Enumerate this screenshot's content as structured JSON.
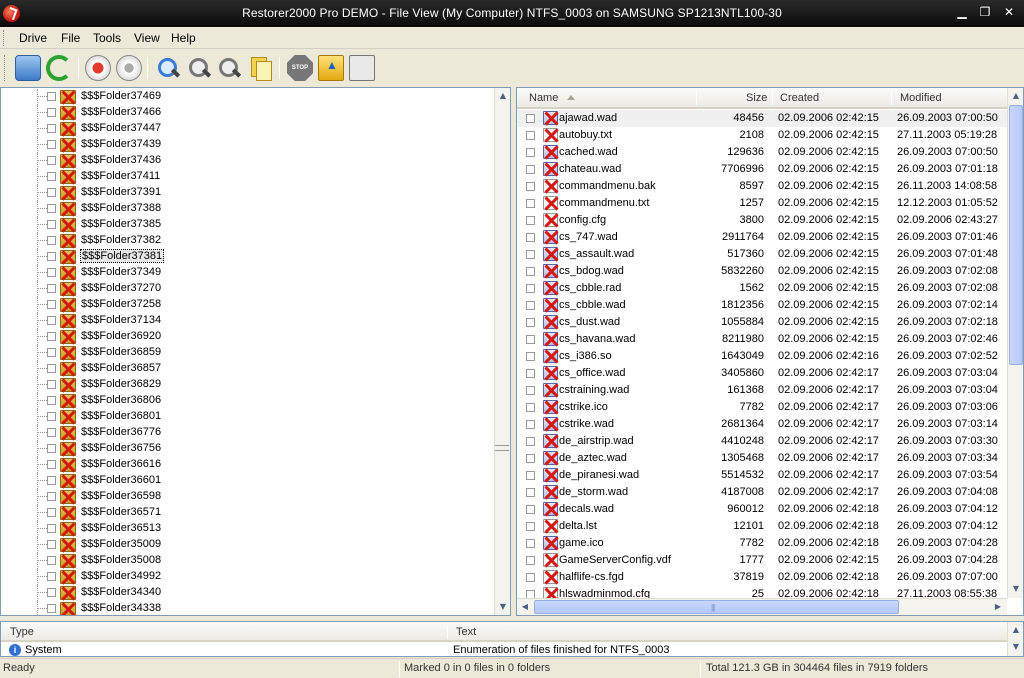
{
  "window": {
    "title": "Restorer2000 Pro DEMO - File View (My Computer) NTFS_0003 on SAMSUNG SP1213NTL100-30"
  },
  "menu": [
    {
      "label": "Drive"
    },
    {
      "label": "File"
    },
    {
      "label": "Tools"
    },
    {
      "label": "View"
    },
    {
      "label": "Help"
    }
  ],
  "toolbar": {
    "buttons": [
      {
        "icon": "drive-icon"
      },
      {
        "icon": "refresh-icon"
      },
      {
        "icon": "mark-icon"
      },
      {
        "icon": "unmark-icon"
      },
      {
        "icon": "find-icon"
      },
      {
        "icon": "find-next-icon"
      },
      {
        "icon": "find-files-icon"
      },
      {
        "icon": "copy-icon"
      },
      {
        "icon": "stop-icon"
      },
      {
        "icon": "up-folder-icon"
      },
      {
        "icon": "properties-icon"
      }
    ]
  },
  "tree": {
    "selected": "$$$Folder37381",
    "items": [
      "$$$Folder37469",
      "$$$Folder37466",
      "$$$Folder37447",
      "$$$Folder37439",
      "$$$Folder37436",
      "$$$Folder37411",
      "$$$Folder37391",
      "$$$Folder37388",
      "$$$Folder37385",
      "$$$Folder37382",
      "$$$Folder37381",
      "$$$Folder37349",
      "$$$Folder37270",
      "$$$Folder37258",
      "$$$Folder37134",
      "$$$Folder36920",
      "$$$Folder36859",
      "$$$Folder36857",
      "$$$Folder36829",
      "$$$Folder36806",
      "$$$Folder36801",
      "$$$Folder36776",
      "$$$Folder36756",
      "$$$Folder36616",
      "$$$Folder36601",
      "$$$Folder36598",
      "$$$Folder36571",
      "$$$Folder36513",
      "$$$Folder35009",
      "$$$Folder35008",
      "$$$Folder34992",
      "$$$Folder34340",
      "$$$Folder34338"
    ]
  },
  "list": {
    "columns": {
      "name": "Name",
      "size": "Size",
      "created": "Created",
      "modified": "Modified"
    },
    "rows": [
      {
        "name": "ajawad.wad",
        "size": "48456",
        "created": "02.09.2006 02:42:15",
        "modified": "26.09.2003 07:00:50",
        "icon": "deleted-file-icon"
      },
      {
        "name": "autobuy.txt",
        "size": "2108",
        "created": "02.09.2006 02:42:15",
        "modified": "27.11.2003 05:19:28",
        "icon": "deleted-text-icon"
      },
      {
        "name": "cached.wad",
        "size": "129636",
        "created": "02.09.2006 02:42:15",
        "modified": "26.09.2003 07:00:50",
        "icon": "deleted-file-icon"
      },
      {
        "name": "chateau.wad",
        "size": "7706996",
        "created": "02.09.2006 02:42:15",
        "modified": "26.09.2003 07:01:18",
        "icon": "deleted-file-icon"
      },
      {
        "name": "commandmenu.bak",
        "size": "8597",
        "created": "02.09.2006 02:42:15",
        "modified": "26.11.2003 14:08:58",
        "icon": "deleted-text-icon"
      },
      {
        "name": "commandmenu.txt",
        "size": "1257",
        "created": "02.09.2006 02:42:15",
        "modified": "12.12.2003 01:05:52",
        "icon": "deleted-text-icon"
      },
      {
        "name": "config.cfg",
        "size": "3800",
        "created": "02.09.2006 02:42:15",
        "modified": "02.09.2006 02:43:27",
        "icon": "deleted-text-icon"
      },
      {
        "name": "cs_747.wad",
        "size": "2911764",
        "created": "02.09.2006 02:42:15",
        "modified": "26.09.2003 07:01:46",
        "icon": "deleted-file-icon"
      },
      {
        "name": "cs_assault.wad",
        "size": "517360",
        "created": "02.09.2006 02:42:15",
        "modified": "26.09.2003 07:01:48",
        "icon": "deleted-file-icon"
      },
      {
        "name": "cs_bdog.wad",
        "size": "5832260",
        "created": "02.09.2006 02:42:15",
        "modified": "26.09.2003 07:02:08",
        "icon": "deleted-file-icon"
      },
      {
        "name": "cs_cbble.rad",
        "size": "1562",
        "created": "02.09.2006 02:42:15",
        "modified": "26.09.2003 07:02:08",
        "icon": "deleted-file-icon"
      },
      {
        "name": "cs_cbble.wad",
        "size": "1812356",
        "created": "02.09.2006 02:42:15",
        "modified": "26.09.2003 07:02:14",
        "icon": "deleted-file-icon"
      },
      {
        "name": "cs_dust.wad",
        "size": "1055884",
        "created": "02.09.2006 02:42:15",
        "modified": "26.09.2003 07:02:18",
        "icon": "deleted-file-icon"
      },
      {
        "name": "cs_havana.wad",
        "size": "8211980",
        "created": "02.09.2006 02:42:15",
        "modified": "26.09.2003 07:02:46",
        "icon": "deleted-file-icon"
      },
      {
        "name": "cs_i386.so",
        "size": "1643049",
        "created": "02.09.2006 02:42:16",
        "modified": "26.09.2003 07:02:52",
        "icon": "deleted-file-icon"
      },
      {
        "name": "cs_office.wad",
        "size": "3405860",
        "created": "02.09.2006 02:42:17",
        "modified": "26.09.2003 07:03:04",
        "icon": "deleted-file-icon"
      },
      {
        "name": "cstraining.wad",
        "size": "161368",
        "created": "02.09.2006 02:42:17",
        "modified": "26.09.2003 07:03:04",
        "icon": "deleted-file-icon"
      },
      {
        "name": "cstrike.ico",
        "size": "7782",
        "created": "02.09.2006 02:42:17",
        "modified": "26.09.2003 07:03:06",
        "icon": "deleted-file-icon"
      },
      {
        "name": "cstrike.wad",
        "size": "2681364",
        "created": "02.09.2006 02:42:17",
        "modified": "26.09.2003 07:03:14",
        "icon": "deleted-file-icon"
      },
      {
        "name": "de_airstrip.wad",
        "size": "4410248",
        "created": "02.09.2006 02:42:17",
        "modified": "26.09.2003 07:03:30",
        "icon": "deleted-file-icon"
      },
      {
        "name": "de_aztec.wad",
        "size": "1305468",
        "created": "02.09.2006 02:42:17",
        "modified": "26.09.2003 07:03:34",
        "icon": "deleted-file-icon"
      },
      {
        "name": "de_piranesi.wad",
        "size": "5514532",
        "created": "02.09.2006 02:42:17",
        "modified": "26.09.2003 07:03:54",
        "icon": "deleted-file-icon"
      },
      {
        "name": "de_storm.wad",
        "size": "4187008",
        "created": "02.09.2006 02:42:17",
        "modified": "26.09.2003 07:04:08",
        "icon": "deleted-file-icon"
      },
      {
        "name": "decals.wad",
        "size": "960012",
        "created": "02.09.2006 02:42:18",
        "modified": "26.09.2003 07:04:12",
        "icon": "deleted-file-icon"
      },
      {
        "name": "delta.lst",
        "size": "12101",
        "created": "02.09.2006 02:42:18",
        "modified": "26.09.2003 07:04:12",
        "icon": "deleted-text-icon"
      },
      {
        "name": "game.ico",
        "size": "7782",
        "created": "02.09.2006 02:42:18",
        "modified": "26.09.2003 07:04:28",
        "icon": "deleted-file-icon"
      },
      {
        "name": "GameServerConfig.vdf",
        "size": "1777",
        "created": "02.09.2006 02:42:15",
        "modified": "26.09.2003 07:04:28",
        "icon": "deleted-text-icon"
      },
      {
        "name": "halflife-cs.fgd",
        "size": "37819",
        "created": "02.09.2006 02:42:18",
        "modified": "26.09.2003 07:07:00",
        "icon": "deleted-text-icon"
      },
      {
        "name": "hlswadminmod.cfg",
        "size": "25",
        "created": "02.09.2006 02:42:18",
        "modified": "27.11.2003 08:55:38",
        "icon": "deleted-text-icon"
      }
    ]
  },
  "log": {
    "columns": {
      "type": "Type",
      "text": "Text"
    },
    "rows": [
      {
        "type": "System",
        "text": "Enumeration of files finished for NTFS_0003"
      }
    ]
  },
  "status": {
    "ready": "Ready",
    "marked": "Marked 0 in 0 files in 0 folders",
    "total": "Total 121.3 GB in 304464 files in 7919 folders"
  }
}
